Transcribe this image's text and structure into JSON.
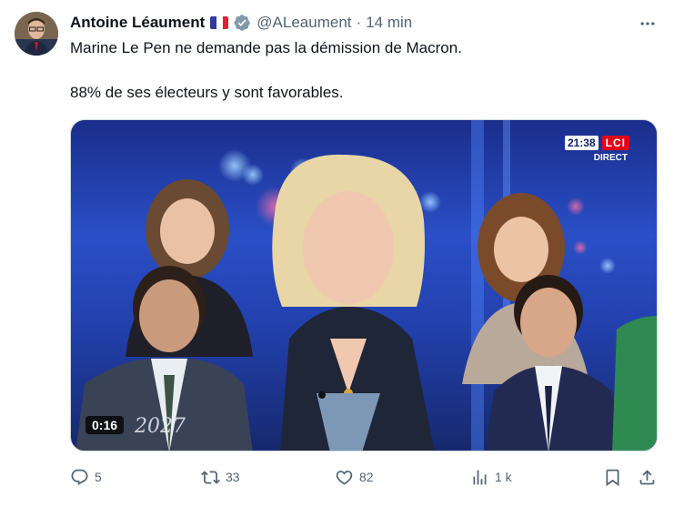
{
  "tweet": {
    "author_name": "Antoine Léaument",
    "handle": "@ALeaument",
    "separator": "·",
    "time": "14 min",
    "line1": "Marine Le Pen ne demande pas la démission de Macron.",
    "line2": "88% de ses électeurs y sont favorables.",
    "verified_icon": "verified-badge-icon",
    "flag": "france-flag"
  },
  "media": {
    "overlay_time": "21:38",
    "overlay_logo": "LCI",
    "overlay_live": "DIRECT",
    "duration": "0:16",
    "desk_mark": "2027"
  },
  "actions": {
    "replies": "5",
    "reposts": "33",
    "likes": "82",
    "views": "1 k"
  },
  "colors": {
    "text": "#0f1419",
    "muted": "#536471",
    "verified": "#829aab",
    "lci_red": "#e2001a"
  }
}
